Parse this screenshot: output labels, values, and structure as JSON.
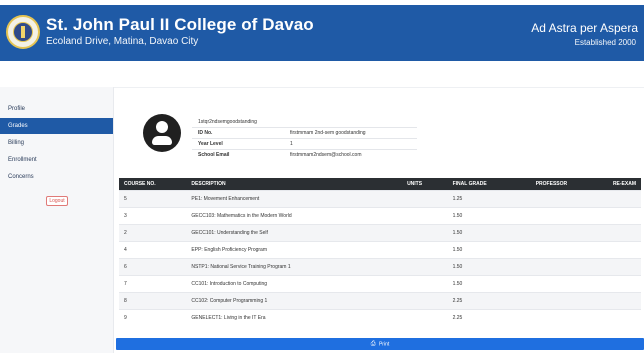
{
  "header": {
    "title": "St. John Paul II College of Davao",
    "address": "Ecoland Drive, Matina, Davao City",
    "motto": "Ad Astra per Aspera",
    "established": "Established 2000",
    "colors": {
      "brand": "#1f5aa6"
    }
  },
  "sidebar": {
    "items": [
      {
        "label": "Profile",
        "active": false
      },
      {
        "label": "Grades",
        "active": true
      },
      {
        "label": "Billing",
        "active": false
      },
      {
        "label": "Enrollment",
        "active": false
      },
      {
        "label": "Concerns",
        "active": false
      }
    ],
    "logout_label": "Logout"
  },
  "profile": {
    "username": "1stqr2ndsemgoodstanding",
    "fields": [
      {
        "key": "ID No.",
        "value": "firstmmam 2nd-sem goodstanding"
      },
      {
        "key": "Year Level",
        "value": "1"
      },
      {
        "key": "School Email",
        "value": "firstmmam2ndsem@school.com"
      }
    ]
  },
  "grades": {
    "columns": [
      "COURSE NO.",
      "DESCRIPTION",
      "UNITS",
      "FINAL GRADE",
      "PROFESSOR",
      "RE-EXAM"
    ],
    "rows": [
      {
        "course_no": "5",
        "description": "PE1: Movement Enhancement",
        "units": "",
        "final_grade": "1.25",
        "professor": "",
        "re_exam": ""
      },
      {
        "course_no": "3",
        "description": "GECC103: Mathematics in the Modern World",
        "units": "",
        "final_grade": "1.50",
        "professor": "",
        "re_exam": ""
      },
      {
        "course_no": "2",
        "description": "GECC101: Understanding the Self",
        "units": "",
        "final_grade": "1.50",
        "professor": "",
        "re_exam": ""
      },
      {
        "course_no": "4",
        "description": "EPP: English Proficiency Program",
        "units": "",
        "final_grade": "1.50",
        "professor": "",
        "re_exam": ""
      },
      {
        "course_no": "6",
        "description": "NSTP1: National Service Training Program 1",
        "units": "",
        "final_grade": "1.50",
        "professor": "",
        "re_exam": ""
      },
      {
        "course_no": "7",
        "description": "CC101: Introduction to Computing",
        "units": "",
        "final_grade": "1.50",
        "professor": "",
        "re_exam": ""
      },
      {
        "course_no": "8",
        "description": "CC102: Computer Programming 1",
        "units": "",
        "final_grade": "2.25",
        "professor": "",
        "re_exam": ""
      },
      {
        "course_no": "9",
        "description": "GENELECT1: Living in the IT Era",
        "units": "",
        "final_grade": "2.25",
        "professor": "",
        "re_exam": ""
      }
    ]
  },
  "actions": {
    "print_label": "Print",
    "print_icon": "printer-icon"
  }
}
